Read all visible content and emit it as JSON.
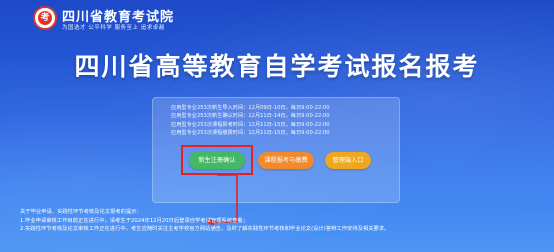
{
  "header": {
    "logo_mark": "考",
    "site_name": "四川省教育考试院",
    "slogan": "为国选才 公平科学 服务至上 追求卓越"
  },
  "page_title": "四川省高等教育自学考试报名报考",
  "info_lines": [
    "应用型专业253次新生导入时间：12月09日-10日，每日9:00-22:00",
    "应用型专业253次新生确认时间：12月11日-14日，每日9:00-22:00",
    "应用型专业253次课程报考时间：12月11日-15日，每日9:00-22:00",
    "应用型专业253次课程缴费时间：12月11日-15日，每日9:00-22:00"
  ],
  "buttons": {
    "register": "新生注册确认",
    "course": "课程报考与缴费",
    "admin": "管理端入口"
  },
  "colors": {
    "register": "#45b865",
    "course": "#f18a2c",
    "admin": "#efa81d",
    "highlight": "#e5211d"
  },
  "notice": [
    "关于毕业申请、实践性环节考核及论文报考的提示：",
    "1.毕业申请审核工作目前正在进行中，请考生于2024年12月20日后登录自学考试管理系统查看；",
    "2.实践性环节考核及论文审核工作正在进行中，考生应随时关注主考学校官方网站通告，及时了解实践性环节考核和毕业论文(设计)答辩工作安排及相关要求。"
  ]
}
